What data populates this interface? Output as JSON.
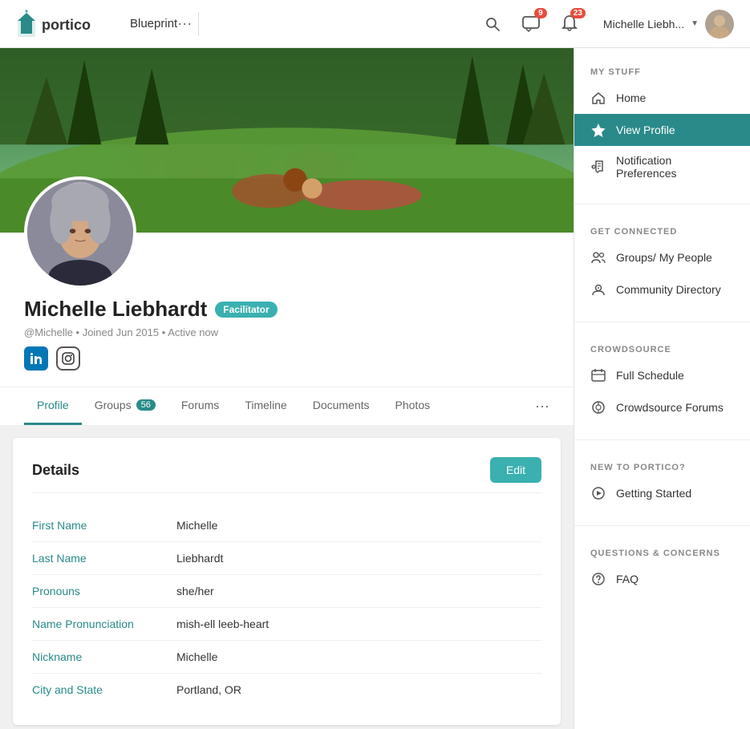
{
  "nav": {
    "logo_text": "portico",
    "blueprint_label": "Blueprint",
    "more_label": "···",
    "messages_badge": "9",
    "notifications_badge": "23",
    "user_name": "Michelle Liebh...",
    "user_name_full": "Michelle Liebhardt"
  },
  "profile": {
    "name": "Michelle Liebhardt",
    "badge": "Facilitator",
    "handle": "@Michelle",
    "joined": "Joined Jun 2015",
    "status": "Active now",
    "meta_separator": "•"
  },
  "tabs": [
    {
      "label": "Profile",
      "active": true,
      "count": null
    },
    {
      "label": "Groups",
      "active": false,
      "count": "56"
    },
    {
      "label": "Forums",
      "active": false,
      "count": null
    },
    {
      "label": "Timeline",
      "active": false,
      "count": null
    },
    {
      "label": "Documents",
      "active": false,
      "count": null
    },
    {
      "label": "Photos",
      "active": false,
      "count": null
    }
  ],
  "details": {
    "title": "Details",
    "edit_label": "Edit",
    "fields": [
      {
        "label": "First Name",
        "value": "Michelle"
      },
      {
        "label": "Last Name",
        "value": "Liebhardt"
      },
      {
        "label": "Pronouns",
        "value": "she/her"
      },
      {
        "label": "Name Pronunciation",
        "value": "mish-ell leeb-heart"
      },
      {
        "label": "Nickname",
        "value": "Michelle"
      },
      {
        "label": "City and State",
        "value": "Portland, OR"
      }
    ]
  },
  "sidebar": {
    "my_stuff_title": "MY STUFF",
    "home_label": "Home",
    "view_profile_label": "View Profile",
    "notification_pref_label": "Notification Preferences",
    "get_connected_title": "GET CONNECTED",
    "groups_label": "Groups/ My People",
    "community_dir_label": "Community Directory",
    "crowdsource_title": "CROWDSOURCE",
    "full_schedule_label": "Full Schedule",
    "crowdsource_forums_label": "Crowdsource Forums",
    "new_to_portico_title": "NEW TO PORTICO?",
    "getting_started_label": "Getting Started",
    "questions_title": "QUESTIONS & CONCERNS",
    "faq_label": "FAQ"
  }
}
